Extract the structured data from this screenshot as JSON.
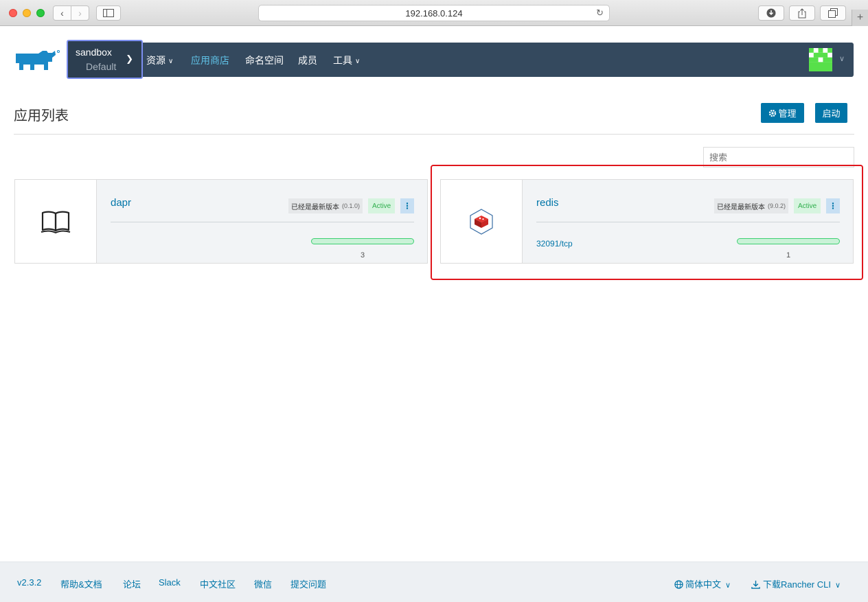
{
  "browser": {
    "url": "192.168.0.124"
  },
  "header": {
    "cluster_name": "sandbox",
    "project_name": "Default",
    "nav": [
      {
        "label": "资源",
        "has_caret": true,
        "active": false
      },
      {
        "label": "应用商店",
        "has_caret": false,
        "active": true
      },
      {
        "label": "命名空间",
        "has_caret": false,
        "active": false
      },
      {
        "label": "成员",
        "has_caret": false,
        "active": false
      },
      {
        "label": "工具",
        "has_caret": true,
        "active": false
      }
    ]
  },
  "page": {
    "title": "应用列表",
    "manage_label": "管理",
    "launch_label": "启动",
    "search_placeholder": "搜索"
  },
  "apps": [
    {
      "name": "dapr",
      "icon": "book-icon",
      "version_text": "已经是最新版本",
      "version": "(0.1.0)",
      "state": "Active",
      "port": "",
      "progress": 1.0,
      "count": "3"
    },
    {
      "name": "redis",
      "icon": "redis-icon",
      "version_text": "已经是最新版本",
      "version": "(9.0.2)",
      "state": "Active",
      "port": "32091/tcp",
      "progress": 1.0,
      "count": "1"
    }
  ],
  "footer": {
    "version": "v2.3.2",
    "links": [
      "帮助&文档",
      "论坛",
      "Slack",
      "中文社区",
      "微信",
      "提交问题"
    ],
    "language": "简体中文",
    "cli": "下载Rancher CLI"
  },
  "colors": {
    "nav_bg": "#34495e",
    "accent": "#0075a8",
    "active_nav": "#5fc1e6",
    "highlight": "#e0161c"
  }
}
